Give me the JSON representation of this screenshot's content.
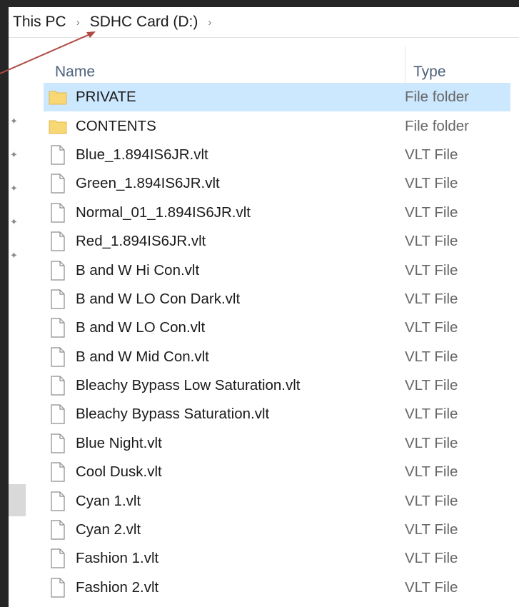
{
  "breadcrumb": {
    "items": [
      "This PC",
      "SDHC Card (D:)"
    ],
    "separator": "›"
  },
  "columns": {
    "name": "Name",
    "type": "Type"
  },
  "files": [
    {
      "name": "PRIVATE",
      "type": "File folder",
      "icon": "folder-icon"
    },
    {
      "name": "CONTENTS",
      "type": "File folder",
      "icon": "folder-icon"
    },
    {
      "name": "Blue_1.894IS6JR.vlt",
      "type": "VLT File",
      "icon": "file-icon"
    },
    {
      "name": "Green_1.894IS6JR.vlt",
      "type": "VLT File",
      "icon": "file-icon"
    },
    {
      "name": "Normal_01_1.894IS6JR.vlt",
      "type": "VLT File",
      "icon": "file-icon"
    },
    {
      "name": "Red_1.894IS6JR.vlt",
      "type": "VLT File",
      "icon": "file-icon"
    },
    {
      "name": "B and W Hi Con.vlt",
      "type": "VLT File",
      "icon": "file-icon"
    },
    {
      "name": "B and W LO Con Dark.vlt",
      "type": "VLT File",
      "icon": "file-icon"
    },
    {
      "name": "B and W LO Con.vlt",
      "type": "VLT File",
      "icon": "file-icon"
    },
    {
      "name": "B and W Mid Con.vlt",
      "type": "VLT File",
      "icon": "file-icon"
    },
    {
      "name": "Bleachy Bypass Low Saturation.vlt",
      "type": "VLT File",
      "icon": "file-icon"
    },
    {
      "name": "Bleachy Bypass Saturation.vlt",
      "type": "VLT File",
      "icon": "file-icon"
    },
    {
      "name": "Blue Night.vlt",
      "type": "VLT File",
      "icon": "file-icon"
    },
    {
      "name": "Cool Dusk.vlt",
      "type": "VLT File",
      "icon": "file-icon"
    },
    {
      "name": "Cyan 1.vlt",
      "type": "VLT File",
      "icon": "file-icon"
    },
    {
      "name": "Cyan 2.vlt",
      "type": "VLT File",
      "icon": "file-icon"
    },
    {
      "name": "Fashion 1.vlt",
      "type": "VLT File",
      "icon": "file-icon"
    },
    {
      "name": "Fashion 2.vlt",
      "type": "VLT File",
      "icon": "file-icon"
    }
  ],
  "colors": {
    "selection": "#cce8ff",
    "folder": "#f8d775",
    "annotation_arrow": "#b04a44"
  }
}
